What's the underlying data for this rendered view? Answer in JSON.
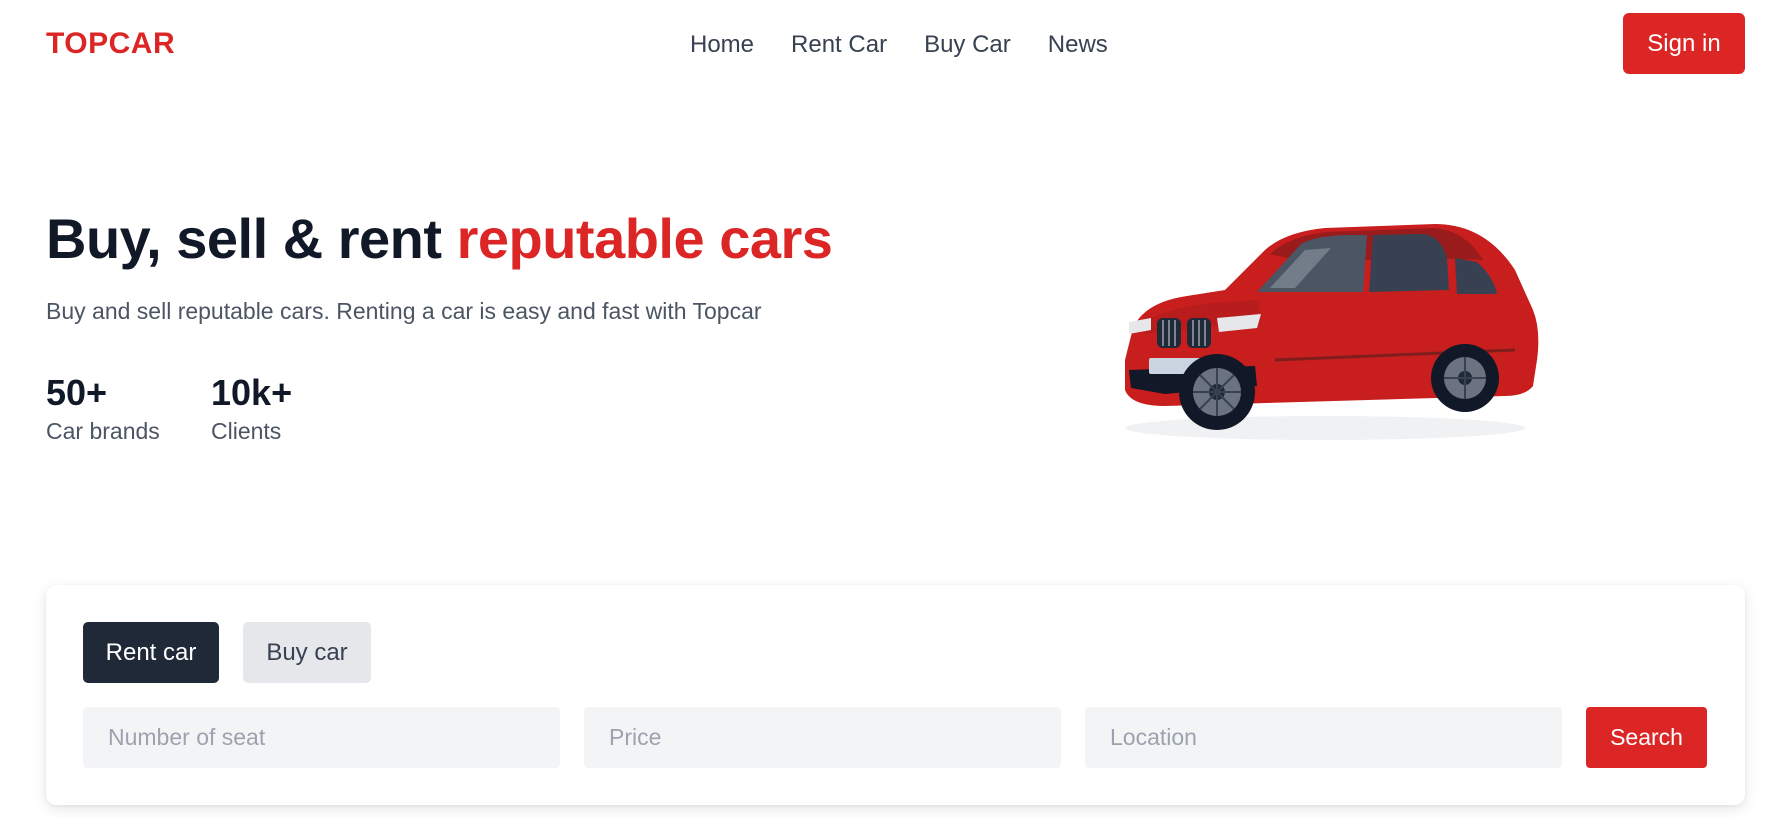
{
  "header": {
    "logo": "TOPCAR",
    "nav": [
      "Home",
      "Rent Car",
      "Buy Car",
      "News"
    ],
    "signin_label": "Sign in"
  },
  "hero": {
    "title_plain": "Buy, sell & rent ",
    "title_accent": "reputable cars",
    "subtitle": "Buy and sell reputable cars. Renting a car is easy and fast with Topcar",
    "stats": [
      {
        "value": "50+",
        "label": "Car brands"
      },
      {
        "value": "10k+",
        "label": "Clients"
      }
    ],
    "image": "red-suv-car"
  },
  "search": {
    "tabs": [
      "Rent car",
      "Buy car"
    ],
    "active_tab": "Rent car",
    "fields": {
      "seats_placeholder": "Number of seat",
      "price_placeholder": "Price",
      "location_placeholder": "Location"
    },
    "search_label": "Search"
  },
  "colors": {
    "brand": "#dc2626",
    "dark": "#1f2937",
    "muted_bg": "#f3f4f6"
  }
}
